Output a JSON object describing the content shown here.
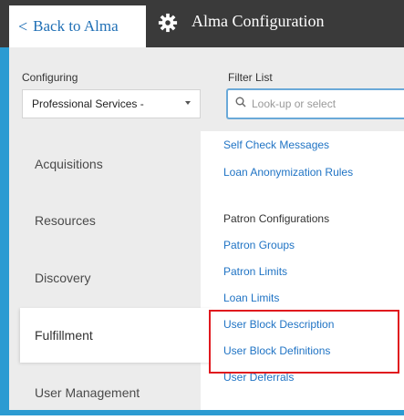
{
  "header": {
    "back_label": "Back to Alma",
    "back_chevron": "<",
    "title": "Alma Configuration",
    "icons": {
      "settings": "gear-icon",
      "back": "chevron-left-icon",
      "search": "search-icon",
      "dropdown": "chevron-down-icon"
    }
  },
  "configuring": {
    "label": "Configuring",
    "selected": "Professional Services -"
  },
  "filter": {
    "label": "Filter List",
    "placeholder": "Look-up or select"
  },
  "nav": {
    "items": [
      {
        "label": "Acquisitions"
      },
      {
        "label": "Resources"
      },
      {
        "label": "Discovery"
      },
      {
        "label": "Fulfillment"
      },
      {
        "label": "User Management"
      }
    ],
    "active": "Fulfillment"
  },
  "list": {
    "links_top": [
      "Self Check Messages",
      "Loan Anonymization Rules"
    ],
    "section_heading": "Patron Configurations",
    "links_section": [
      "Patron Groups",
      "Patron Limits",
      "Loan Limits",
      "User Block Description",
      "User Block Definitions",
      "User Deferrals"
    ]
  },
  "colors": {
    "frame": "#2b9bd2",
    "header": "#3a3a3a",
    "link": "#1f73c4",
    "highlight": "#e0191e"
  }
}
